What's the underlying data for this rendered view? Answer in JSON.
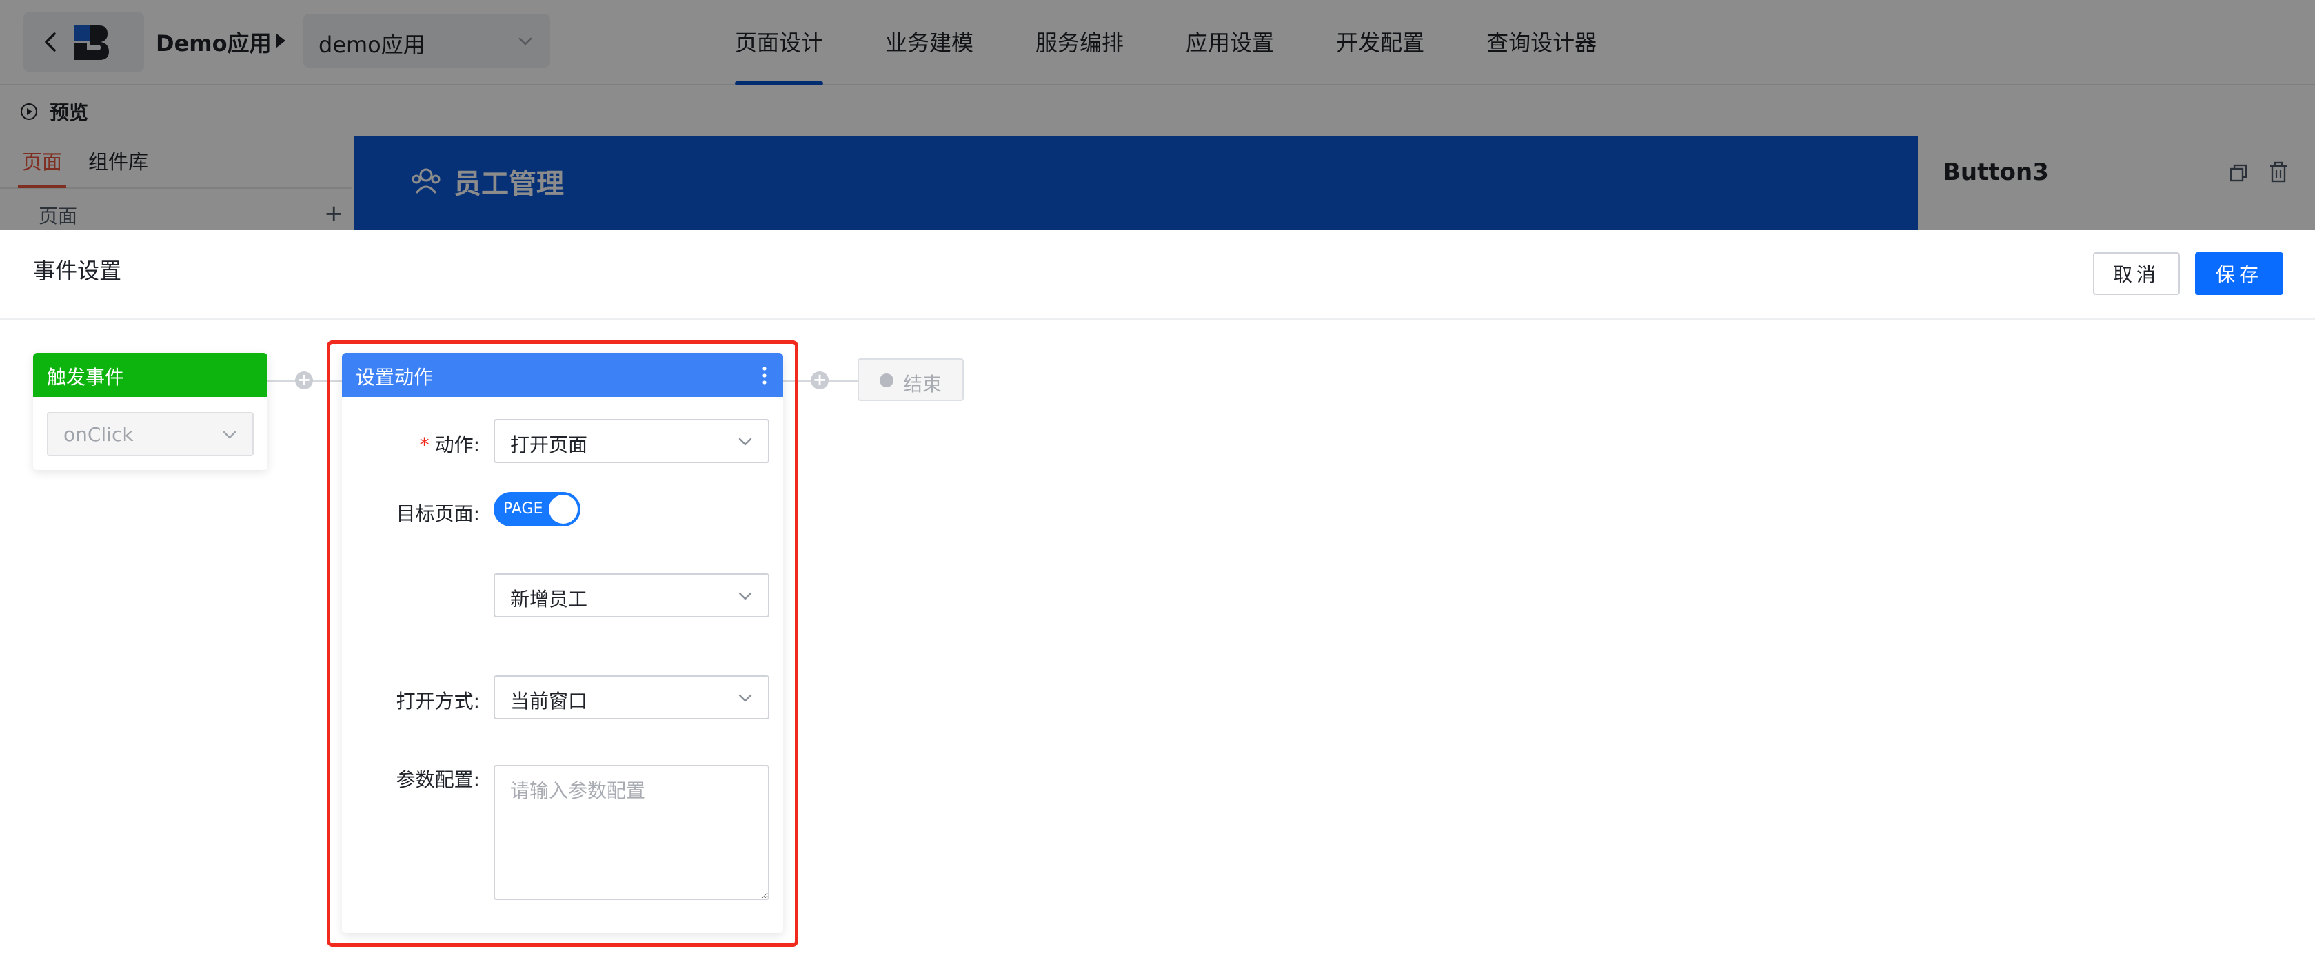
{
  "header": {
    "app_name": "Demo应用",
    "app_select_value": "demo应用",
    "nav_tabs": [
      {
        "label": "页面设计",
        "active": true
      },
      {
        "label": "业务建模",
        "active": false
      },
      {
        "label": "服务编排",
        "active": false
      },
      {
        "label": "应用设置",
        "active": false
      },
      {
        "label": "开发配置",
        "active": false
      },
      {
        "label": "查询设计器",
        "active": false
      }
    ]
  },
  "left_panel": {
    "preview_label": "预览",
    "tabs": [
      {
        "label": "页面",
        "active": true
      },
      {
        "label": "组件库",
        "active": false
      }
    ],
    "pages_label": "页面",
    "add_symbol": "+"
  },
  "canvas": {
    "banner_title": "员工管理",
    "banner_color": "#0b5ad8"
  },
  "right_panel": {
    "component_title": "Button3"
  },
  "drawer": {
    "title": "事件设置",
    "cancel_label": "取消",
    "save_label": "保存",
    "trigger_node": {
      "title": "触发事件",
      "event_value": "onClick",
      "color": "#0eb40e"
    },
    "action_node": {
      "title": "设置动作",
      "color": "#3c82f6",
      "fields": {
        "action_label": "动作:",
        "action_required_mark": "*",
        "action_value": "打开页面",
        "target_label": "目标页面:",
        "target_toggle_text": "PAGE",
        "target_page_value": "新增员工",
        "open_mode_label": "打开方式:",
        "open_mode_value": "当前窗口",
        "params_label": "参数配置:",
        "params_placeholder": "请输入参数配置"
      }
    },
    "end_node": {
      "label": "结束"
    },
    "highlight_color": "#f02b1d"
  }
}
